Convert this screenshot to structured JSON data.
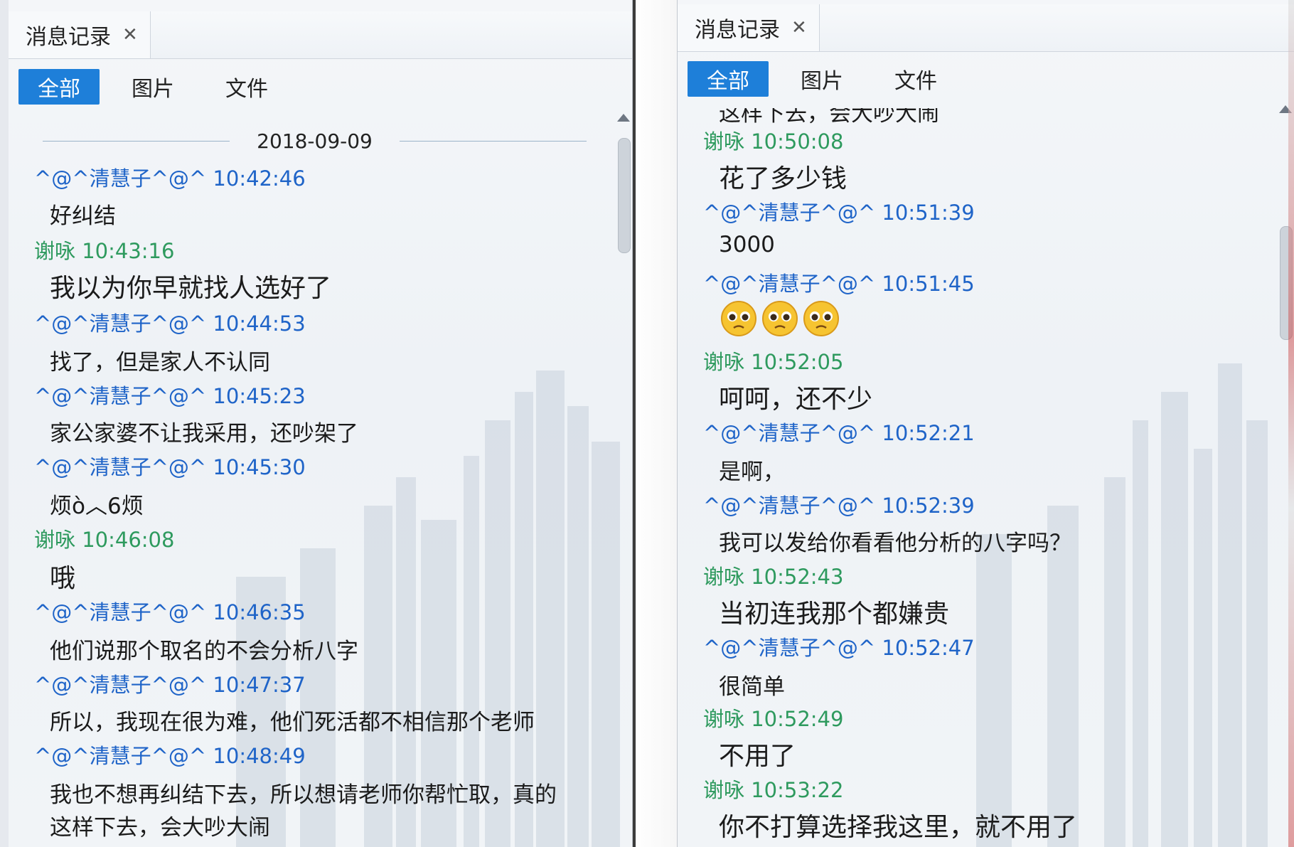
{
  "left": {
    "tab_label": "消息记录",
    "filters": [
      "全部",
      "图片",
      "文件"
    ],
    "date": "2018-09-09",
    "messages": [
      {
        "sender": "^@^清慧子^@^ 10:42:46",
        "text": "好纠结",
        "color": "blue"
      },
      {
        "sender": "谢咏 10:43:16",
        "text": "我以为你早就找人选好了",
        "color": "green"
      },
      {
        "sender": "^@^清慧子^@^ 10:44:53",
        "text": "找了，但是家人不认同",
        "color": "blue"
      },
      {
        "sender": "^@^清慧子^@^ 10:45:23",
        "text": "家公家婆不让我采用，还吵架了",
        "color": "blue"
      },
      {
        "sender": "^@^清慧子^@^ 10:45:30",
        "text": "烦ò︿6烦",
        "color": "blue"
      },
      {
        "sender": "谢咏 10:46:08",
        "text": "哦",
        "color": "green"
      },
      {
        "sender": "^@^清慧子^@^ 10:46:35",
        "text": "他们说那个取名的不会分析八字",
        "color": "blue"
      },
      {
        "sender": "^@^清慧子^@^ 10:47:37",
        "text": "所以，我现在很为难，他们死活都不相信那个老师",
        "color": "blue"
      },
      {
        "sender": "^@^清慧子^@^ 10:48:49",
        "text": "我也不想再纠结下去，所以想请老师你帮忙取，真的",
        "color": "blue"
      },
      {
        "sender": "",
        "text": "这样下去，会大吵大闹",
        "color": "blue"
      }
    ]
  },
  "right": {
    "tab_label": "消息记录",
    "filters": [
      "全部",
      "图片",
      "文件"
    ],
    "partial_text": "这样下去，会大吵大闹",
    "messages": [
      {
        "sender": "谢咏 10:50:08",
        "text": "花了多少钱",
        "color": "green"
      },
      {
        "sender": "^@^清慧子^@^ 10:51:39",
        "text": "3000",
        "color": "blue"
      },
      {
        "sender": "^@^清慧子^@^ 10:51:45",
        "text": "",
        "color": "blue"
      },
      {
        "sender": "谢咏 10:52:05",
        "text": "呵呵，还不少",
        "color": "green"
      },
      {
        "sender": "^@^清慧子^@^ 10:52:21",
        "text": "是啊，",
        "color": "blue"
      },
      {
        "sender": "^@^清慧子^@^ 10:52:39",
        "text": "我可以发给你看看他分析的八字吗？",
        "color": "blue"
      },
      {
        "sender": "谢咏 10:52:43",
        "text": "当初连我那个都嫌贵",
        "color": "green"
      },
      {
        "sender": "^@^清慧子^@^ 10:52:47",
        "text": "很简单",
        "color": "blue"
      },
      {
        "sender": "谢咏 10:52:49",
        "text": "不用了",
        "color": "green"
      },
      {
        "sender": "谢咏 10:53:22",
        "text": "你不打算选择我这里，就不用了",
        "color": "green"
      }
    ],
    "emoji": [
      "pleading-face-icon",
      "pleading-face-icon",
      "pleading-face-icon"
    ]
  },
  "colors": {
    "accent": "#1e7fd9",
    "sender_blue": "#1f64c8",
    "sender_green": "#2e9a5e"
  }
}
